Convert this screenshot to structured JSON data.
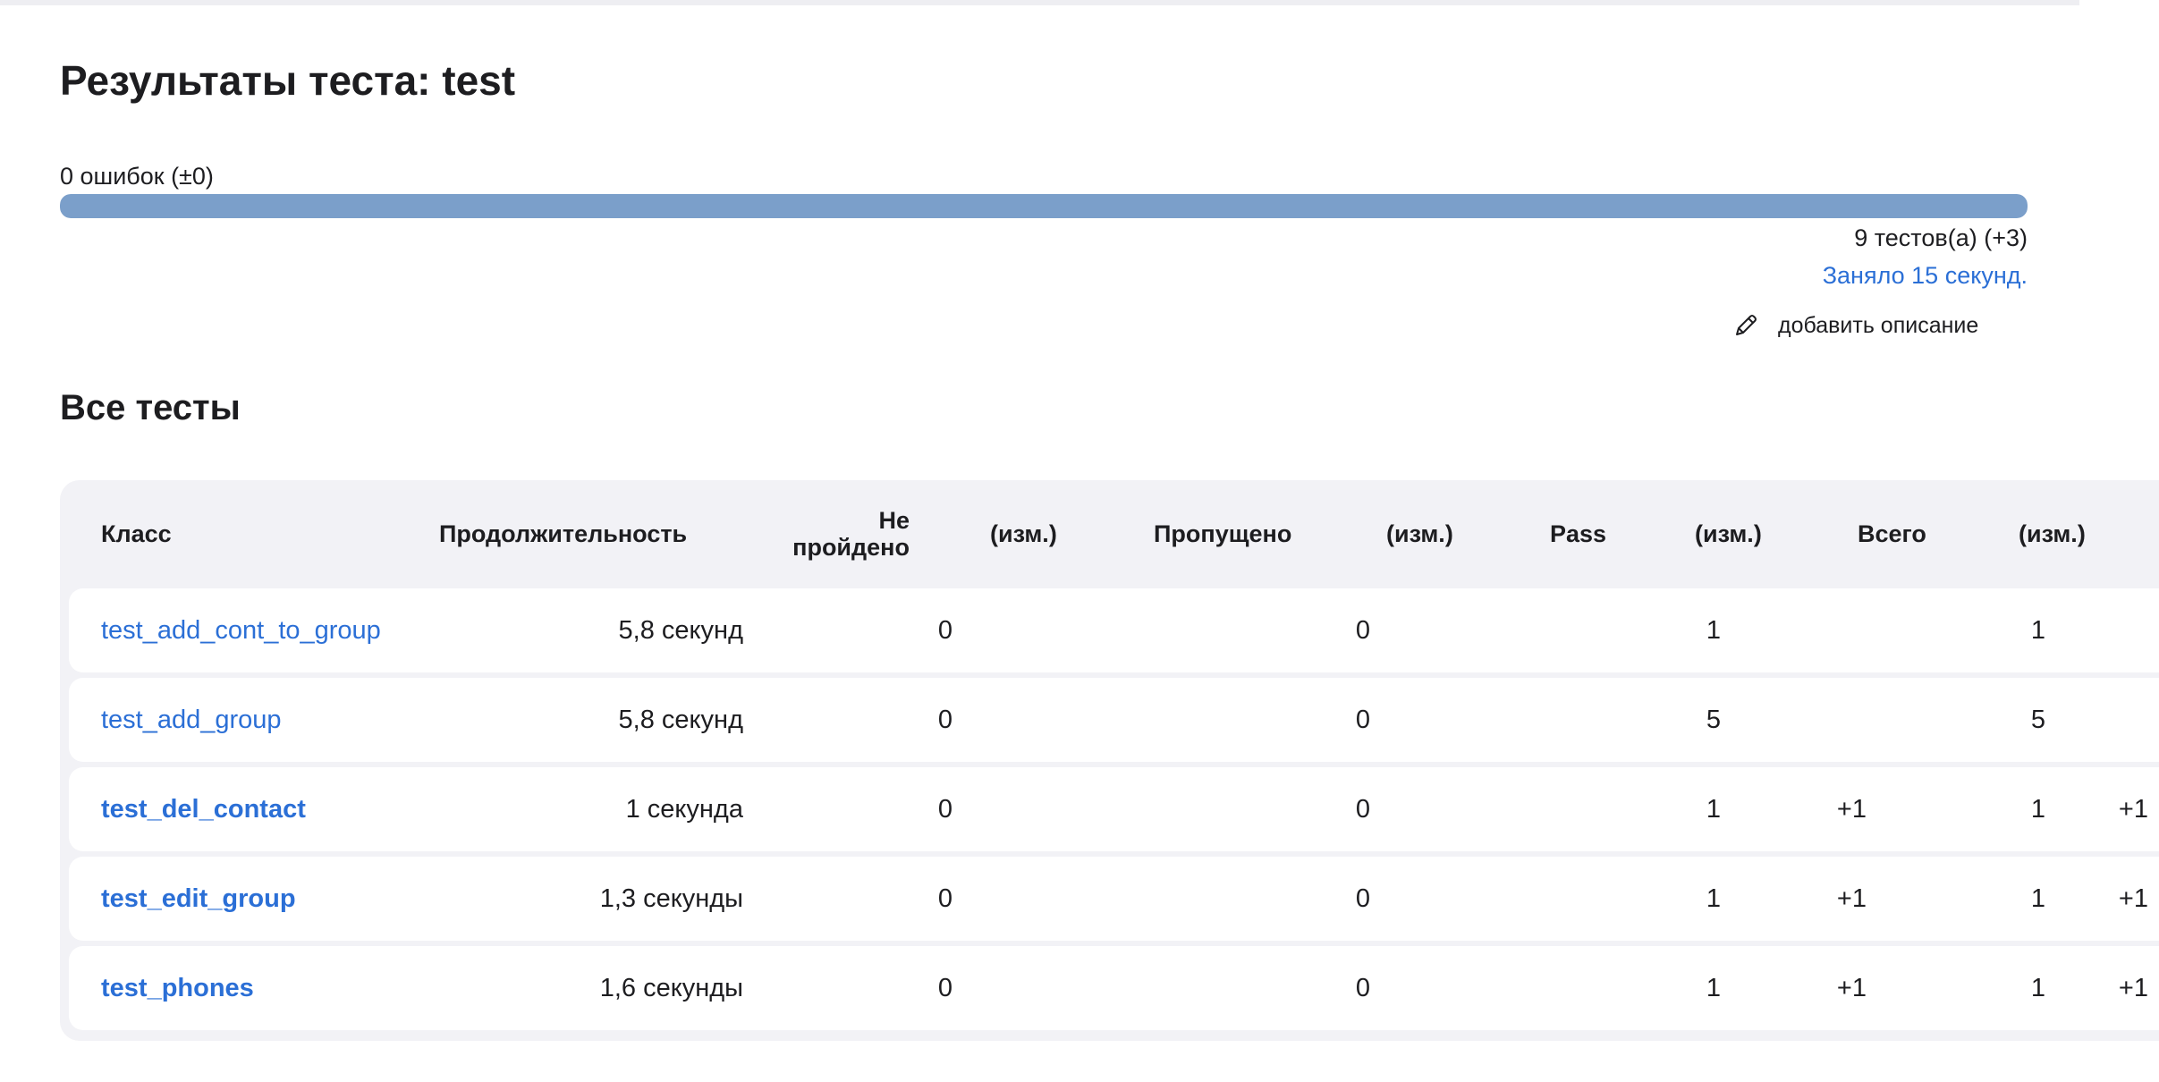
{
  "header": {
    "title": "Результаты теста: test"
  },
  "summary": {
    "fail_text": "0 ошибок (±0)",
    "fail_fraction": 0,
    "tests_text": "9 тестов(а) (+3)",
    "duration_text": "Заняло 15 секунд.",
    "add_description_label": "добавить описание"
  },
  "section": {
    "title": "Все тесты"
  },
  "table": {
    "columns": {
      "class": "Класс",
      "duration": "Продолжительность",
      "failed": "Не пройдено",
      "failed_diff": "(изм.)",
      "skipped": "Пропущено",
      "skipped_diff": "(изм.)",
      "pass": "Pass",
      "pass_diff": "(изм.)",
      "total": "Всего",
      "total_diff": "(изм.)"
    },
    "rows": [
      {
        "name": "test_add_cont_to_group",
        "bold": false,
        "duration": "5,8 секунд",
        "failed": "0",
        "failed_diff": "",
        "skipped": "0",
        "skipped_diff": "",
        "pass": "1",
        "pass_diff": "",
        "total": "1",
        "total_diff": ""
      },
      {
        "name": "test_add_group",
        "bold": false,
        "duration": "5,8 секунд",
        "failed": "0",
        "failed_diff": "",
        "skipped": "0",
        "skipped_diff": "",
        "pass": "5",
        "pass_diff": "",
        "total": "5",
        "total_diff": ""
      },
      {
        "name": "test_del_contact",
        "bold": true,
        "duration": "1 секунда",
        "failed": "0",
        "failed_diff": "",
        "skipped": "0",
        "skipped_diff": "",
        "pass": "1",
        "pass_diff": "+1",
        "total": "1",
        "total_diff": "+1"
      },
      {
        "name": "test_edit_group",
        "bold": true,
        "duration": "1,3 секунды",
        "failed": "0",
        "failed_diff": "",
        "skipped": "0",
        "skipped_diff": "",
        "pass": "1",
        "pass_diff": "+1",
        "total": "1",
        "total_diff": "+1"
      },
      {
        "name": "test_phones",
        "bold": true,
        "duration": "1,6 секунды",
        "failed": "0",
        "failed_diff": "",
        "skipped": "0",
        "skipped_diff": "",
        "pass": "1",
        "pass_diff": "+1",
        "total": "1",
        "total_diff": "+1"
      }
    ]
  },
  "colors": {
    "link": "#2b6fd6",
    "progress_pass": "#7b9fca",
    "table_bg": "#f2f2f6"
  },
  "icons": {
    "add_description": "pencil-icon"
  }
}
